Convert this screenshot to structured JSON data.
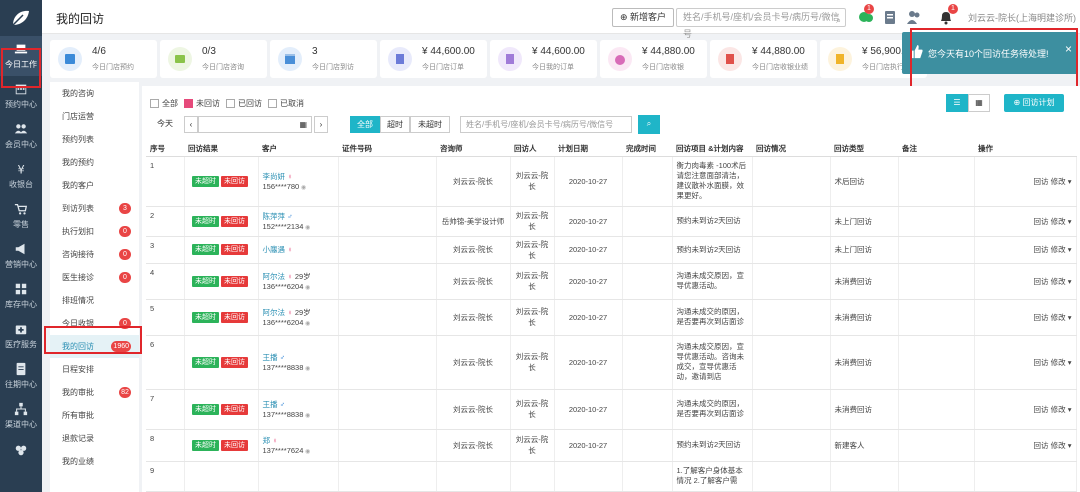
{
  "header": {
    "title": "我的回访",
    "new_customer": "新增客户",
    "search_placeholder": "姓名/手机号/座机/会员卡号/病历号/微信号",
    "badges": [
      "1",
      "1"
    ],
    "user": "刘云云-院长(上海明建诊所)"
  },
  "nav": [
    {
      "label": "今日工作",
      "icon": "laptop-icon"
    },
    {
      "label": "预约中心",
      "icon": "calendar-icon"
    },
    {
      "label": "会员中心",
      "icon": "users-icon"
    },
    {
      "label": "收银台",
      "icon": "yen-icon"
    },
    {
      "label": "零售",
      "icon": "cart-icon"
    },
    {
      "label": "营销中心",
      "icon": "megaphone-icon"
    },
    {
      "label": "库存中心",
      "icon": "grid-icon"
    },
    {
      "label": "医疗服务",
      "icon": "medical-icon"
    },
    {
      "label": "往期中心",
      "icon": "document-icon"
    },
    {
      "label": "渠道中心",
      "icon": "network-icon"
    }
  ],
  "stats": [
    {
      "value": "4/6",
      "label": "今日门店预约",
      "color": "#3b8ad8"
    },
    {
      "value": "0/3",
      "label": "今日门店咨询",
      "color": "#8bc34a"
    },
    {
      "value": "3",
      "label": "今日门店到访",
      "color": "#4a8fd8"
    },
    {
      "value": "¥ 44,600.00",
      "label": "今日门店订单",
      "color": "#6c7bd8"
    },
    {
      "value": "¥ 44,600.00",
      "label": "今日我的订单",
      "color": "#a07bd8"
    },
    {
      "value": "¥ 44,880.00",
      "label": "今日门店收银",
      "color": "#d86cb8"
    },
    {
      "value": "¥ 44,880.00",
      "label": "今日门店收银业绩",
      "color": "#e0504a"
    },
    {
      "value": "¥ 56,900.00",
      "label": "今日门店执行业绩",
      "color": "#f0b429"
    }
  ],
  "notice": {
    "text": "您今天有10个回访任务待处理!",
    "close": "×"
  },
  "submenu": [
    {
      "label": "我的咨询",
      "count": ""
    },
    {
      "label": "门店运营",
      "count": ""
    },
    {
      "label": "预约列表",
      "count": ""
    },
    {
      "label": "我的预约",
      "count": ""
    },
    {
      "label": "我的客户",
      "count": ""
    },
    {
      "label": "到访列表",
      "count": "3"
    },
    {
      "label": "执行划扣",
      "count": "0"
    },
    {
      "label": "咨询接待",
      "count": "0"
    },
    {
      "label": "医生接诊",
      "count": "0"
    },
    {
      "label": "排班情况",
      "count": ""
    },
    {
      "label": "今日收银",
      "count": "0"
    },
    {
      "label": "我的回访",
      "count": "1960"
    },
    {
      "label": "日程安排",
      "count": ""
    },
    {
      "label": "我的审批",
      "count": "82"
    },
    {
      "label": "所有审批",
      "count": ""
    },
    {
      "label": "退款记录",
      "count": ""
    },
    {
      "label": "我的业绩",
      "count": ""
    }
  ],
  "filters": {
    "all": "全部",
    "not_visited": "未回访",
    "visited": "已回访",
    "cancelled": "已取消",
    "today": "今天",
    "tab_all": "全部",
    "tab_overdue": "超时",
    "tab_not_overdue": "未超时",
    "search_placeholder": "姓名/手机号/座机/会员卡号/病历号/微信号",
    "plan_button": "回访计划"
  },
  "table": {
    "columns": [
      "序号",
      "回访结果",
      "客户",
      "证件号码",
      "咨询师",
      "回访人",
      "计划日期",
      "完成时间",
      "回访项目 &计划内容",
      "回访情况",
      "回访类型",
      "备注",
      "操作"
    ],
    "tag_overdue": "未超时",
    "tag_not_visited": "未回访",
    "ops": "回访 修改",
    "rows": [
      {
        "no": "1",
        "name": "李尚妍",
        "gender": "♀",
        "age": "",
        "phone": "156****780",
        "consultant": "刘云云-院长",
        "visitor": "刘云云-院长",
        "date": "2020-10-27",
        "content": "衡力肉毒素 -100术后请您注意面部清洁，建议散补水面膜，效果更好。",
        "type": "术后回访"
      },
      {
        "no": "2",
        "name": "陈萍萍",
        "gender": "♂",
        "age": "",
        "phone": "152****2134",
        "consultant": "岳帅锦-美学设计师",
        "visitor": "刘云云-院长",
        "date": "2020-10-27",
        "content": "预约未到访2天回访",
        "type": "未上门回访"
      },
      {
        "no": "3",
        "name": "小廛遇",
        "gender": "♀",
        "age": "",
        "phone": "",
        "consultant": "刘云云-院长",
        "visitor": "刘云云-院长",
        "date": "2020-10-27",
        "content": "预约未到访2天回访",
        "type": "未上门回访"
      },
      {
        "no": "4",
        "name": "阿尔法",
        "gender": "♀",
        "age": "29岁",
        "phone": "136****6204",
        "consultant": "刘云云-院长",
        "visitor": "刘云云-院长",
        "date": "2020-10-27",
        "content": "沟通未成交原因，宣导优惠活动。",
        "type": "未消费回访"
      },
      {
        "no": "5",
        "name": "阿尔法",
        "gender": "♀",
        "age": "29岁",
        "phone": "136****6204",
        "consultant": "刘云云-院长",
        "visitor": "刘云云-院长",
        "date": "2020-10-27",
        "content": "沟通未成交的原因，是否要再次到店面诊",
        "type": "未消费回访"
      },
      {
        "no": "6",
        "name": "王播",
        "gender": "♂",
        "age": "",
        "phone": "137****8838",
        "consultant": "刘云云-院长",
        "visitor": "刘云云-院长",
        "date": "2020-10-27",
        "content": "沟通未成交原因，宣导优惠活动。咨询未成交，宣导优惠活动，邀请到店",
        "type": "未消费回访"
      },
      {
        "no": "7",
        "name": "王播",
        "gender": "♂",
        "age": "",
        "phone": "137****8838",
        "consultant": "刘云云-院长",
        "visitor": "刘云云-院长",
        "date": "2020-10-27",
        "content": "沟通未成交的原因，是否要再次到店面诊",
        "type": "未消费回访"
      },
      {
        "no": "8",
        "name": "郑",
        "gender": "♀",
        "age": "",
        "phone": "137****7624",
        "consultant": "刘云云-院长",
        "visitor": "刘云云-院长",
        "date": "2020-10-27",
        "content": "预约未到访2天回访",
        "type": "新建客人"
      },
      {
        "no": "9",
        "name": "",
        "gender": "",
        "age": "",
        "phone": "",
        "consultant": "",
        "visitor": "",
        "date": "",
        "content": "1.了解客户身体基本情况 2.了解客户需",
        "type": ""
      }
    ]
  }
}
